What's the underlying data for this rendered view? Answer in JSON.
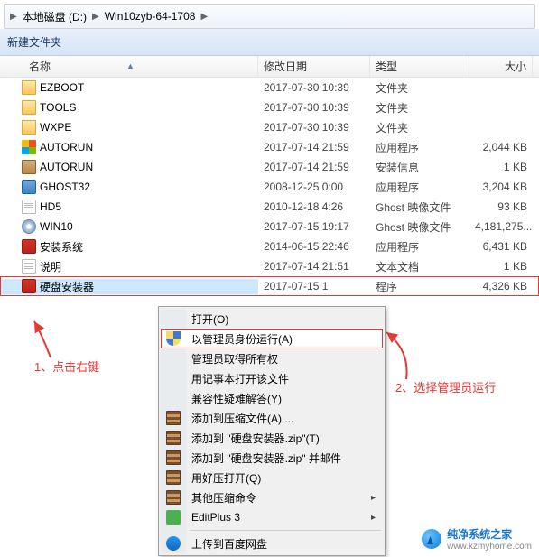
{
  "breadcrumb": {
    "drive": "本地磁盘 (D:)",
    "folder": "Win10zyb-64-1708"
  },
  "toolbar": {
    "new_folder": "新建文件夹"
  },
  "columns": {
    "name": "名称",
    "date": "修改日期",
    "type": "类型",
    "size": "大小"
  },
  "files": [
    {
      "name": "EZBOOT",
      "date": "2017-07-30 10:39",
      "type": "文件夹",
      "size": "",
      "icon": "folder-icon"
    },
    {
      "name": "TOOLS",
      "date": "2017-07-30 10:39",
      "type": "文件夹",
      "size": "",
      "icon": "folder-icon"
    },
    {
      "name": "WXPE",
      "date": "2017-07-30 10:39",
      "type": "文件夹",
      "size": "",
      "icon": "folder-icon"
    },
    {
      "name": "AUTORUN",
      "date": "2017-07-14 21:59",
      "type": "应用程序",
      "size": "2,044 KB",
      "icon": "win-icon"
    },
    {
      "name": "AUTORUN",
      "date": "2017-07-14 21:59",
      "type": "安装信息",
      "size": "1 KB",
      "icon": "box-icon"
    },
    {
      "name": "GHOST32",
      "date": "2008-12-25 0:00",
      "type": "应用程序",
      "size": "3,204 KB",
      "icon": "ghost-icon"
    },
    {
      "name": "HD5",
      "date": "2010-12-18 4:26",
      "type": "Ghost 映像文件",
      "size": "93 KB",
      "icon": "txt-icon"
    },
    {
      "name": "WIN10",
      "date": "2017-07-15 19:17",
      "type": "Ghost 映像文件",
      "size": "4,181,275...",
      "icon": "disc-icon"
    },
    {
      "name": "安装系统",
      "date": "2014-06-15 22:46",
      "type": "应用程序",
      "size": "6,431 KB",
      "icon": "exe-icon"
    },
    {
      "name": "说明",
      "date": "2017-07-14 21:51",
      "type": "文本文档",
      "size": "1 KB",
      "icon": "txt-icon"
    },
    {
      "name": "硬盘安装器",
      "date": "2017-07-15 1",
      "type": "程序",
      "size": "4,326 KB",
      "icon": "exe-icon",
      "selected": true
    }
  ],
  "context_menu": [
    {
      "label": "打开(O)"
    },
    {
      "label": "以管理员身份运行(A)",
      "icon": "shield-icon",
      "selected": true
    },
    {
      "label": "管理员取得所有权"
    },
    {
      "label": "用记事本打开该文件"
    },
    {
      "label": "兼容性疑难解答(Y)"
    },
    {
      "label": "添加到压缩文件(A) ...",
      "icon": "rar-icon"
    },
    {
      "label": "添加到 \"硬盘安装器.zip\"(T)",
      "icon": "rar-icon"
    },
    {
      "label": "添加到 \"硬盘安装器.zip\" 并邮件",
      "icon": "rar-icon"
    },
    {
      "label": "用好压打开(Q)",
      "icon": "rar-icon"
    },
    {
      "label": "其他压缩命令",
      "icon": "rar-icon",
      "sub": true
    },
    {
      "label": "EditPlus 3",
      "icon": "edit-icon",
      "sub": true
    },
    {
      "sep": true
    },
    {
      "label": "上传到百度网盘",
      "icon": "baidu-icon"
    }
  ],
  "annotations": {
    "a1": "1、点击右键",
    "a2": "2、选择管理员运行"
  },
  "watermark": {
    "title": "纯净系统之家",
    "url": "www.kzmyhome.com"
  }
}
